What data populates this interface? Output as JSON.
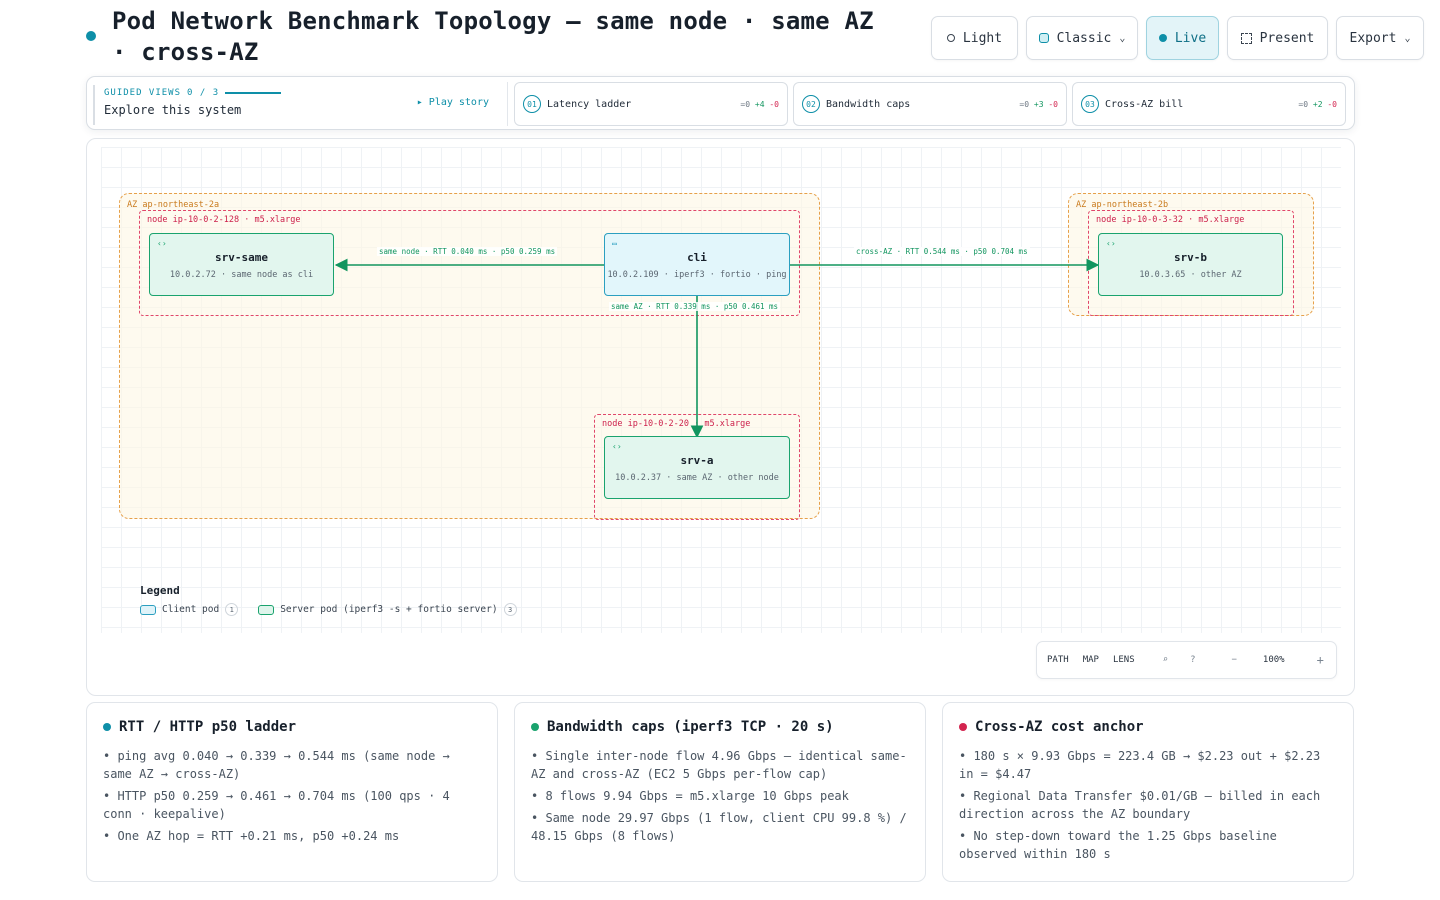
{
  "header": {
    "title": "Pod Network Benchmark Topology — same node · same AZ · cross-AZ",
    "buttons": {
      "light": "Light",
      "classic": "Classic",
      "live": "Live",
      "present": "Present",
      "export": "Export"
    }
  },
  "guided": {
    "label": "GUIDED VIEWS",
    "progress": "0 / 3",
    "subtitle": "Explore this system",
    "play": "▸ Play story",
    "views": [
      {
        "num": "01",
        "label": "Latency ladder",
        "eq": "=0",
        "plus": "+4",
        "minus": "-0"
      },
      {
        "num": "02",
        "label": "Bandwidth caps",
        "eq": "=0",
        "plus": "+3",
        "minus": "-0"
      },
      {
        "num": "03",
        "label": "Cross-AZ bill",
        "eq": "=0",
        "plus": "+2",
        "minus": "-0"
      }
    ]
  },
  "diagram": {
    "zones": [
      {
        "label": "AZ ap-northeast-2a"
      },
      {
        "label": "AZ ap-northeast-2b"
      }
    ],
    "nodes": [
      {
        "label": "node ip-10-0-2-128 · m5.xlarge"
      },
      {
        "label": "node ip-10-0-2-20 · m5.xlarge"
      },
      {
        "label": "node ip-10-0-3-32 · m5.xlarge"
      }
    ],
    "pods": {
      "srv_same": {
        "name": "srv-same",
        "sub": "10.0.2.72 · same node as cli"
      },
      "cli": {
        "name": "cli",
        "sub": "10.0.2.109 · iperf3 · fortio · ping"
      },
      "srv_a": {
        "name": "srv-a",
        "sub": "10.0.2.37 · same AZ · other node"
      },
      "srv_b": {
        "name": "srv-b",
        "sub": "10.0.3.65 · other AZ"
      }
    },
    "edges": {
      "same_node": "same node · RTT 0.040 ms · p50 0.259 ms",
      "same_az": "same AZ · RTT 0.339 ms · p50 0.461 ms",
      "cross_az": "cross-AZ · RTT 0.544 ms · p50 0.704 ms"
    },
    "edge_color": "#12955f"
  },
  "legend": {
    "title": "Legend",
    "items": [
      {
        "label": "Client pod",
        "count": "1"
      },
      {
        "label": "Server pod (iperf3 -s + fortio server)",
        "count": "3"
      }
    ]
  },
  "toolbar": {
    "path": "PATH",
    "map": "MAP",
    "lens": "LENS",
    "zoom_out": "−",
    "zoom": "100%",
    "zoom_in": "+"
  },
  "cards": [
    {
      "title": "RTT / HTTP p50 ladder",
      "color": "#0e8fa8",
      "items": [
        "• ping avg 0.040 → 0.339 → 0.544 ms (same node → same AZ → cross-AZ)",
        "• HTTP p50 0.259 → 0.461 → 0.704 ms (100 qps · 4 conn · keepalive)",
        "• One AZ hop = RTT +0.21 ms, p50 +0.24 ms"
      ]
    },
    {
      "title": "Bandwidth caps (iperf3 TCP · 20 s)",
      "color": "#1aa36e",
      "items": [
        "• Single inter-node flow 4.96 Gbps — identical same-AZ and cross-AZ (EC2 5 Gbps per-flow cap)",
        "• 8 flows 9.94 Gbps = m5.xlarge 10 Gbps peak",
        "• Same node 29.97 Gbps (1 flow, client CPU 99.8 %) / 48.15 Gbps (8 flows)"
      ]
    },
    {
      "title": "Cross-AZ cost anchor",
      "color": "#d3244f",
      "items": [
        "• 180 s × 9.93 Gbps = 223.4 GB → $2.23 out + $2.23 in = $4.47",
        "• Regional Data Transfer $0.01/GB — billed in each direction across the AZ boundary",
        "• No step-down toward the 1.25 Gbps baseline observed within 180 s"
      ]
    }
  ]
}
